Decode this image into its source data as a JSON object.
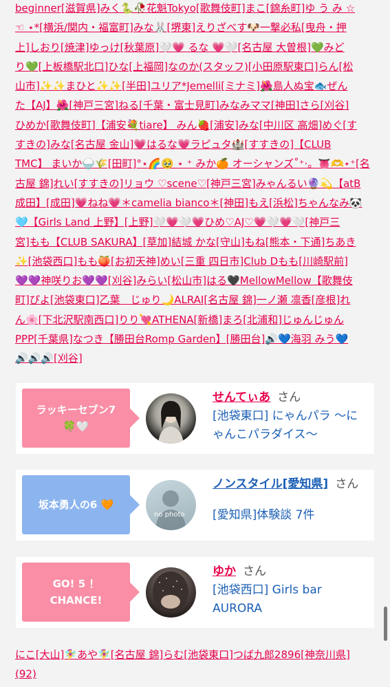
{
  "top_text": {
    "lines": [
      "beginner[滋賀県]みく🐍🥀花魁Tokyo[歌舞伎町]まこ[錦糸町]ゆ う み ☆",
      "☜ ⋆*[横浜/関内・福富町]みな🐰[堺東]えりざべす🐶一撃必私[曳舟・押",
      "上]しおり[焼津]ゆっけ[秋葉原]🤍💗 るな 💗🤍[名古屋 大曽根]💚みど",
      "り💚[上板橋駅北口]ひな[上福岡]なのか(スタッフ)[小田原駅東口]らん[松",
      "山市]✨✨まひと✨✨[半田]ユリア*Jemelli[ミナミ]🌺島人ぬ宝🐟ぜん",
      "た【AJ】🌺[神戸三宮]ねる[千葉・富士見町]みなみママ[神田]さら[刈谷]",
      "ひめか[歌舞伎町]【浦安💐tiare】 みん🍓[浦安]みな[中川区 高畑]めぐ[す",
      "すきの]みな[名古屋 金山]💗はるな💗ラピュタ🏰[すすきの]【CLUB",
      "TMC】 まいか🍚🌾[田町]°⋆🌈🥹 ⋆ ⁺ みか🍊 オーシャンズ˚⁺‧。👅🫶⋆⁺[名",
      "古屋 錦]れい[すすきの]リョウ ♡scene♡[神戸三宮]みゃんるい🔮💫【atB",
      "成田】[成田]💗ねね💗＊camelia bianco＊[神田]もえ[浜松]ちゃんなみ🐼",
      "🩵【Girls Land 上野】[上野]🤍💗🤍💗ひめ♡AJ♡💗🤍💗🤍[神戸三",
      "宮]もも【CLUB SAKURA】[草加]結城 かな[守山]もね[熊本・下通]ちあき",
      "✨[池袋西口]もも🍑[お初天神]めい[三重 四日市]Club Dもも[川崎駅前]",
      "💜💜神咲りお💜💜[刈谷]みらい[松山市]はる🖤MellowMellow【歌舞伎",
      "町]ぴよ[池袋東口]乙葉　じゅり🌙ALRAI[名古屋 錦]一ノ瀬 凛香[彦根]れ",
      "ん🌸[下北沢駅南西口]りり💘ATHENA[新橋]まろ[北浦和]じゅんじゅん",
      "PPP[千葉県]なつき【勝田台Romp Garden】[勝田台]🔊💙海羽 みう💙",
      "🔊🔊🔊[刈谷]"
    ]
  },
  "cards": [
    {
      "badge": "ラッキーセブン7 🍀🤍",
      "badge_color": "#f98ea6",
      "name": "せんてぃあ",
      "san": "さん",
      "shop": "[池袋東口] にゃんパラ 〜にゃんこパラダイス〜",
      "avatar": "photo-dark-hair"
    },
    {
      "badge": "坂本勇人の6 🧡",
      "badge_color": "#8cb4ef",
      "name": "ノンスタイル[愛知県]",
      "san": "さん",
      "shop": "[愛知県]体験談 7件",
      "avatar": "no-photo",
      "avatar_text": "no photo"
    },
    {
      "badge": "GO! 5 ！ CHANCE!",
      "badge_color": "#f98ea6",
      "name": "ゆか",
      "san": "さん",
      "shop": "[池袋西口] Girls bar AURORA",
      "avatar": "photo-glitter"
    }
  ],
  "bottom_text": {
    "lines": [
      "にこ[大山]🧚‍♀️あや🧚‍♀️[名古屋 錦]らむ[池袋東口]つば九郎2896[神奈川県]",
      "(92)"
    ]
  },
  "colors": {
    "pink": "#e6004a",
    "blue": "#1b5fb5",
    "bg": "#f3f3f3"
  }
}
